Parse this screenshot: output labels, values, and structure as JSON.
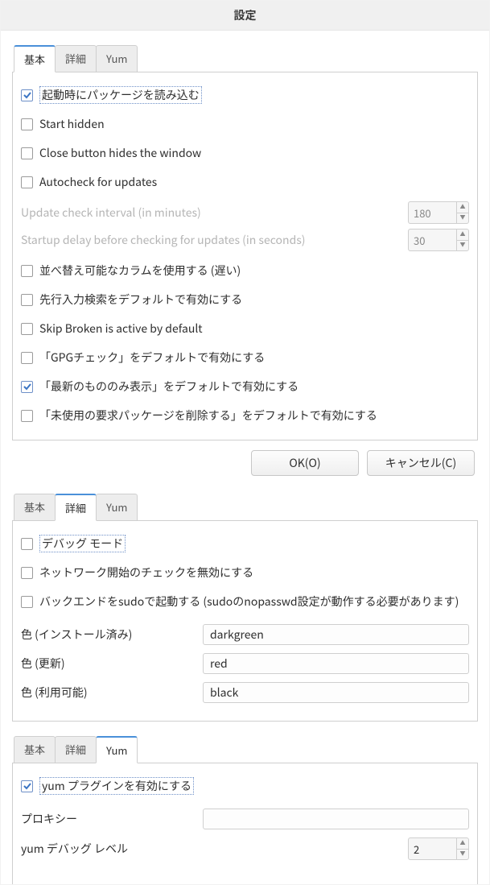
{
  "title": "設定",
  "tabs": {
    "basic": "基本",
    "detail": "詳細",
    "yum": "Yum"
  },
  "basic": {
    "load_on_startup": "起動時にパッケージを読み込む",
    "start_hidden": "Start hidden",
    "close_hides": "Close button hides the window",
    "autocheck": "Autocheck for updates",
    "update_interval_label": "Update check interval (in minutes)",
    "update_interval_value": "180",
    "startup_delay_label": "Startup delay before checking for updates (in seconds)",
    "startup_delay_value": "30",
    "sortable_columns": "並べ替え可能なカラムを使用する (遅い)",
    "typeahead": "先行入力検索をデフォルトで有効にする",
    "skip_broken": "Skip Broken is active by default",
    "gpg_check": "「GPGチェック」をデフォルトで有効にする",
    "latest_only": "「最新のもののみ表示」をデフォルトで有効にする",
    "remove_unused": "「未使用の要求パッケージを削除する」をデフォルトで有効にする"
  },
  "buttons": {
    "ok": "OK(O)",
    "cancel": "キャンセル(C)"
  },
  "detail": {
    "debug_mode": "デバッグ モード",
    "disable_net_check": "ネットワーク開始のチェックを無効にする",
    "sudo_backend": "バックエンドをsudoで起動する (sudoのnopasswd設定が動作する必要があります)",
    "color_installed_label": "色 (インストール済み)",
    "color_installed_value": "darkgreen",
    "color_update_label": "色 (更新)",
    "color_update_value": "red",
    "color_available_label": "色 (利用可能)",
    "color_available_value": "black"
  },
  "yum": {
    "enable_plugins": "yum プラグインを有効にする",
    "proxy_label": "プロキシー",
    "proxy_value": "",
    "debug_level_label": "yum デバッグ レベル",
    "debug_level_value": "2"
  }
}
